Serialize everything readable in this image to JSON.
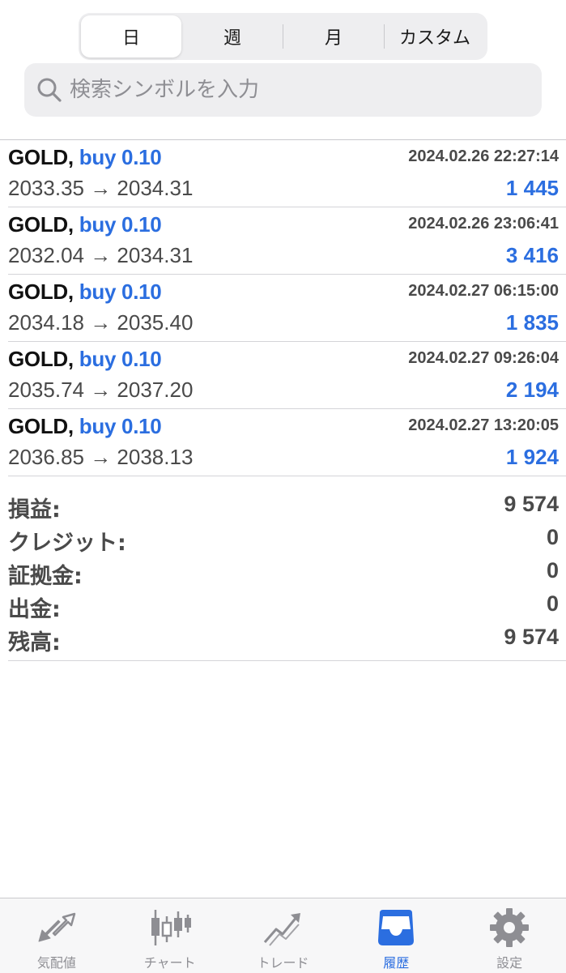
{
  "segments": [
    {
      "label": "日",
      "active": true
    },
    {
      "label": "週",
      "active": false
    },
    {
      "label": "月",
      "active": false
    },
    {
      "label": "カスタム",
      "active": false
    }
  ],
  "search": {
    "placeholder": "検索シンボルを入力"
  },
  "deals": [
    {
      "symbol": "GOLD,",
      "side": "buy 0.10",
      "time": "2024.02.26 22:27:14",
      "prices": "2033.35 → 2034.31",
      "profit": "1 445"
    },
    {
      "symbol": "GOLD,",
      "side": "buy 0.10",
      "time": "2024.02.26 23:06:41",
      "prices": "2032.04 → 2034.31",
      "profit": "3 416"
    },
    {
      "symbol": "GOLD,",
      "side": "buy 0.10",
      "time": "2024.02.27 06:15:00",
      "prices": "2034.18 → 2035.40",
      "profit": "1 835"
    },
    {
      "symbol": "GOLD,",
      "side": "buy 0.10",
      "time": "2024.02.27 09:26:04",
      "prices": "2035.74 → 2037.20",
      "profit": "2 194"
    },
    {
      "symbol": "GOLD,",
      "side": "buy 0.10",
      "time": "2024.02.27 13:20:05",
      "prices": "2036.85 → 2038.13",
      "profit": "1 924"
    }
  ],
  "summary": [
    {
      "label": "損益:",
      "value": "9 574"
    },
    {
      "label": "クレジット:",
      "value": "0"
    },
    {
      "label": "証拠金:",
      "value": "0"
    },
    {
      "label": "出金:",
      "value": "0"
    },
    {
      "label": "残高:",
      "value": "9 574"
    }
  ],
  "tabs": [
    {
      "label": "気配値",
      "icon": "quotes-arrows-icon",
      "active": false
    },
    {
      "label": "チャート",
      "icon": "candlestick-chart-icon",
      "active": false
    },
    {
      "label": "トレード",
      "icon": "trade-trend-icon",
      "active": false
    },
    {
      "label": "履歴",
      "icon": "history-inbox-icon",
      "active": true
    },
    {
      "label": "設定",
      "icon": "settings-gear-icon",
      "active": false
    }
  ],
  "colors": {
    "accent": "#2b6ee0",
    "inactive_icon": "#8e8e93",
    "text_gray": "#4a4a4a"
  }
}
